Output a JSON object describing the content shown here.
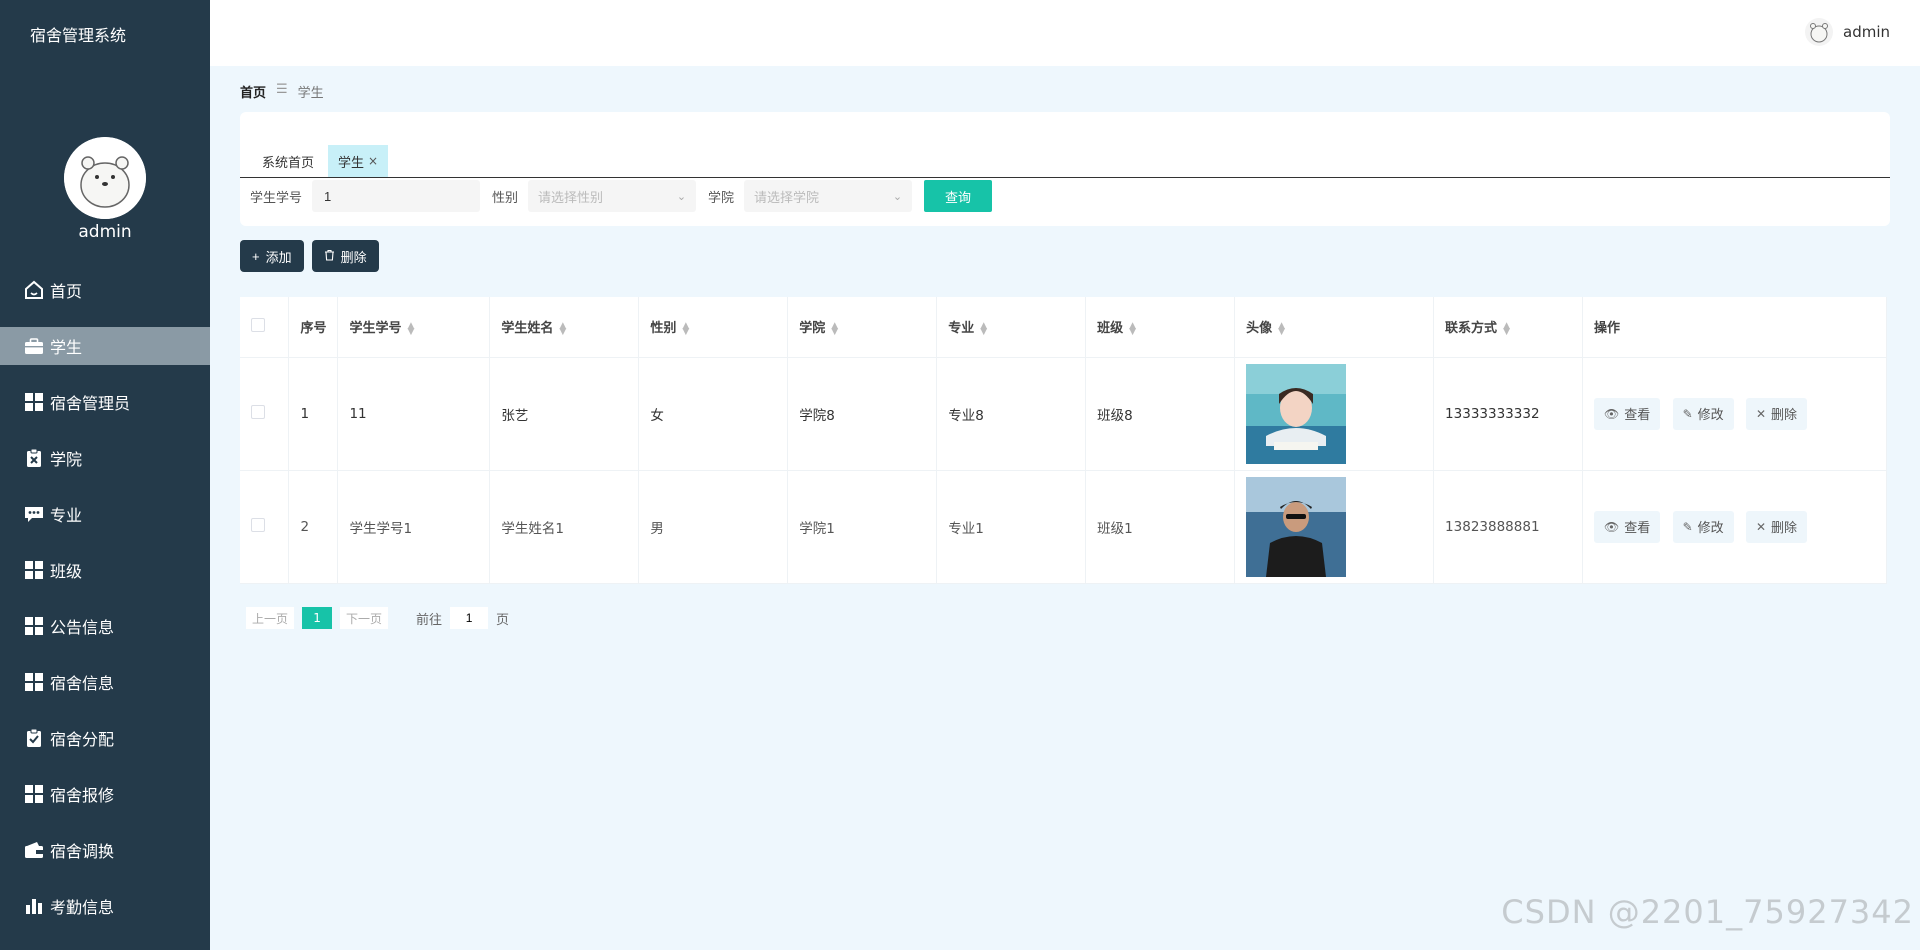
{
  "app": {
    "title": "宿舍管理系统"
  },
  "sidebar": {
    "username": "admin",
    "items": [
      {
        "label": "首页",
        "icon": "home-icon"
      },
      {
        "label": "学生",
        "icon": "briefcase-icon",
        "active": true
      },
      {
        "label": "宿舍管理员",
        "icon": "grid-icon"
      },
      {
        "label": "学院",
        "icon": "clipboard-icon"
      },
      {
        "label": "专业",
        "icon": "chat-icon"
      },
      {
        "label": "班级",
        "icon": "grid-icon"
      },
      {
        "label": "公告信息",
        "icon": "grid-icon"
      },
      {
        "label": "宿舍信息",
        "icon": "grid-icon"
      },
      {
        "label": "宿舍分配",
        "icon": "clipboard-check-icon"
      },
      {
        "label": "宿舍报修",
        "icon": "grid-icon"
      },
      {
        "label": "宿舍调换",
        "icon": "wallet-icon"
      },
      {
        "label": "考勤信息",
        "icon": "bar-chart-icon"
      }
    ]
  },
  "header": {
    "username": "admin"
  },
  "breadcrumb": {
    "home": "首页",
    "separator": "☰",
    "current": "学生"
  },
  "tabs": [
    {
      "label": "系统首页"
    },
    {
      "label": "学生",
      "close": "×"
    }
  ],
  "filters": {
    "student_id_label": "学生学号",
    "student_id_value": "1",
    "gender_label": "性别",
    "gender_placeholder": "请选择性别",
    "college_label": "学院",
    "college_placeholder": "请选择学院",
    "query_label": "查询"
  },
  "actions": {
    "add_label": "添加",
    "delete_label": "删除"
  },
  "table": {
    "columns": [
      "序号",
      "学生学号",
      "学生姓名",
      "性别",
      "学院",
      "专业",
      "班级",
      "头像",
      "联系方式",
      "操作"
    ],
    "rows": [
      {
        "index": "1",
        "student_id": "11",
        "name": "张艺",
        "gender": "女",
        "college": "学院8",
        "major": "专业8",
        "class": "班级8",
        "phone": "13333333332"
      },
      {
        "index": "2",
        "student_id": "学生学号1",
        "name": "学生姓名1",
        "gender": "男",
        "college": "学院1",
        "major": "专业1",
        "class": "班级1",
        "phone": "13823888881"
      }
    ],
    "ops": {
      "view": "查看",
      "edit": "修改",
      "delete": "删除"
    }
  },
  "pagination": {
    "prev": "上一页",
    "current": "1",
    "next": "下一页",
    "goto": "前往",
    "goto_value": "1",
    "page_unit": "页"
  },
  "watermark": "CSDN @2201_75927342",
  "colors": {
    "sidebar": "#243a4a",
    "accent": "#17c3a8",
    "active_tab": "#c8f0f8",
    "background": "#eef7fd"
  }
}
